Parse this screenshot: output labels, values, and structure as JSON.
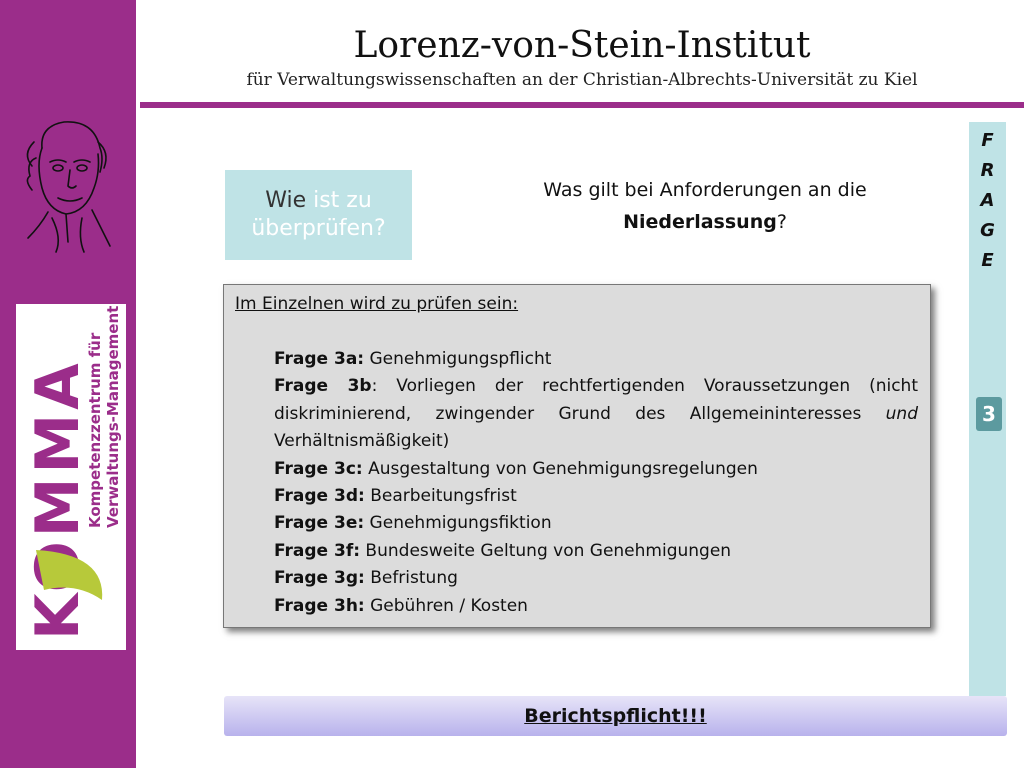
{
  "header": {
    "title": "Lorenz-von-Stein-Institut",
    "subtitle": "für Verwaltungswissenschaften an der Christian-Albrechts-Universität zu Kiel"
  },
  "logo": {
    "text": "KOMMA",
    "line1": "Kompetenzzentrum für",
    "line2": "Verwaltungs-Management",
    "accent_color": "#b7c93a"
  },
  "prompt_box": {
    "part1": "Wie ",
    "part2": "ist zu überprüfen?"
  },
  "question": {
    "line1": "Was gilt bei Anforderungen an die",
    "bold": "Niederlassung",
    "suffix": "?"
  },
  "side": {
    "letters": [
      "F",
      "R",
      "A",
      "G",
      "E"
    ],
    "number": "3"
  },
  "main": {
    "heading": "Im Einzelnen wird zu prüfen sein:",
    "items": [
      {
        "label": "Frage 3a:",
        "text": " Genehmigungspflicht"
      },
      {
        "label": "Frage 3b",
        "text": ": Vorliegen der rechtfertigenden Voraussetzungen (nicht diskriminierend, zwingender Grund des Allgemeininteresses ",
        "em": "und",
        "tail": " Verhältnismäßigkeit)"
      },
      {
        "label": "Frage 3c:",
        "text": " Ausgestaltung von Genehmigungsregelungen"
      },
      {
        "label": "Frage 3d:",
        "text": " Bearbeitungsfrist"
      },
      {
        "label": "Frage 3e:",
        "text": " Genehmigungsfiktion"
      },
      {
        "label": "Frage 3f:",
        "text": " Bundesweite Geltung von Genehmigungen"
      },
      {
        "label": "Frage 3g:",
        "text": " Befristung"
      },
      {
        "label": "Frage 3h:",
        "text": " Gebühren / Kosten"
      }
    ]
  },
  "footer": {
    "label": "Berichtspflicht!!!"
  },
  "colors": {
    "brand_purple": "#9b2d8a",
    "teal_light": "#bfe3e6",
    "teal_dark": "#5c9a9f"
  }
}
